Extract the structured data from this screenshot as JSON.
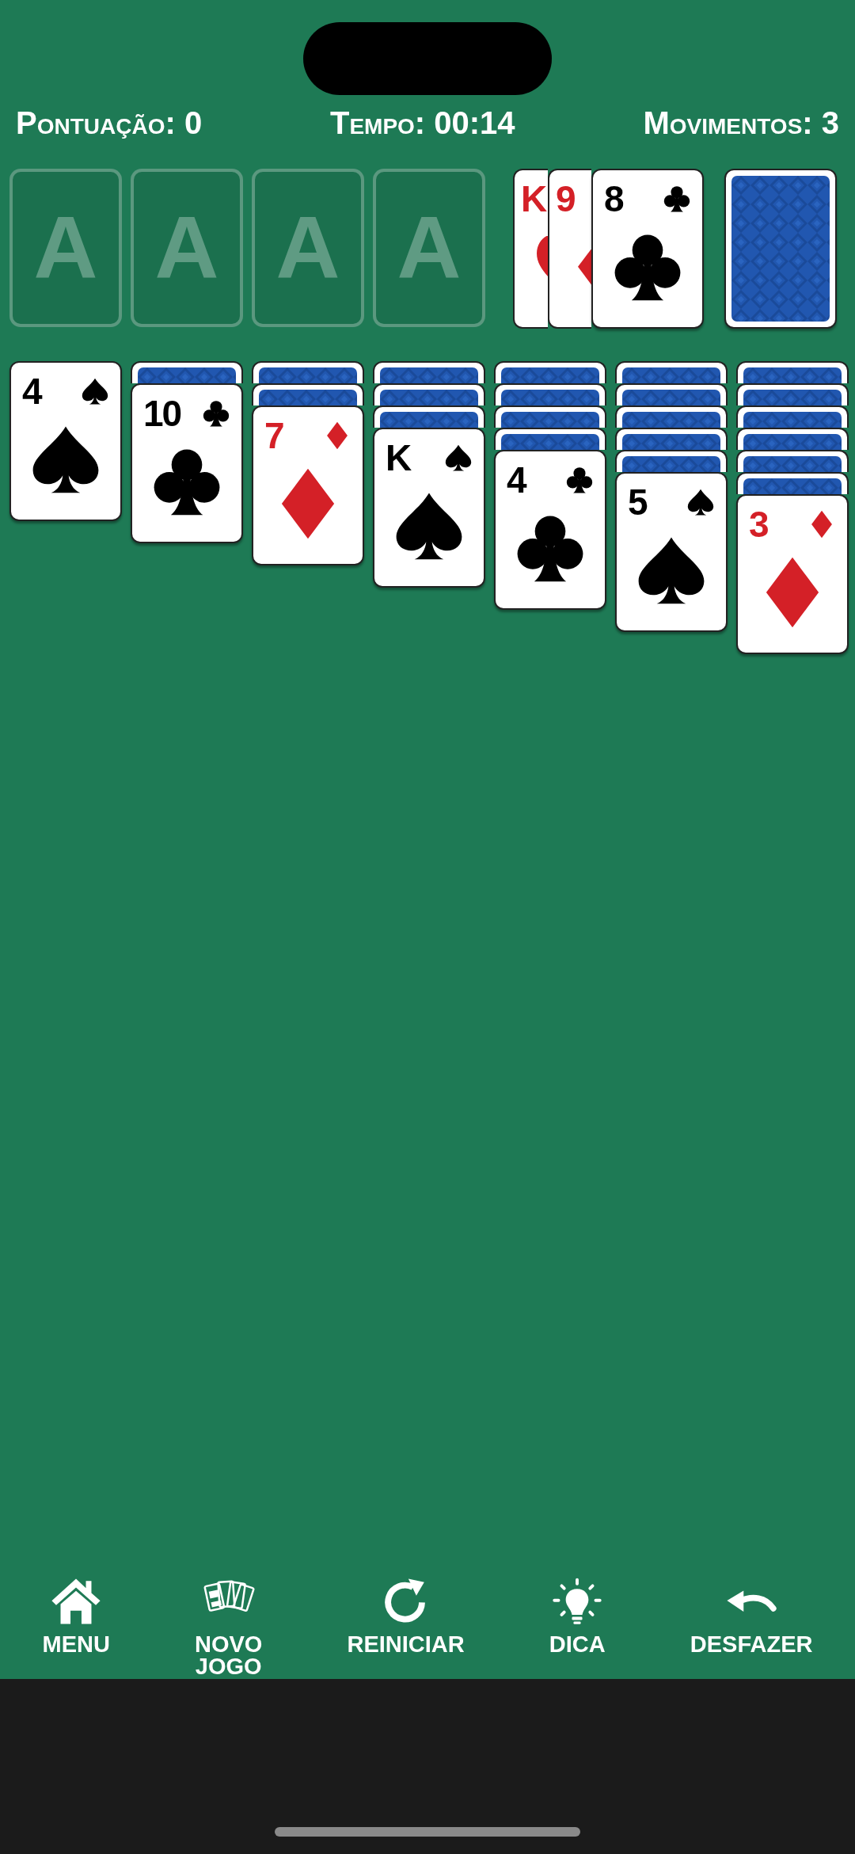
{
  "header": {
    "stats": [
      {
        "text": "Pontuação: 0"
      },
      {
        "text": "Tempo: 00:14"
      },
      {
        "text": "Movimentos: 3"
      }
    ]
  },
  "foundations": [
    {
      "label": "A"
    },
    {
      "label": "A"
    },
    {
      "label": "A"
    },
    {
      "label": "A"
    }
  ],
  "waste": {
    "cards": [
      {
        "rank": "K",
        "kind": "hearts"
      },
      {
        "rank": "9",
        "kind": "diamonds"
      },
      {
        "rank": "8",
        "kind": "clubs"
      }
    ]
  },
  "stock": {
    "face_up": false
  },
  "tableau": [
    {
      "cards": [
        {
          "face_up": true,
          "rank": "4",
          "kind": "spades"
        }
      ]
    },
    {
      "cards": [
        {
          "face_up": false
        },
        {
          "face_up": true,
          "rank": "10",
          "kind": "clubs"
        }
      ]
    },
    {
      "cards": [
        {
          "face_up": false
        },
        {
          "face_up": false
        },
        {
          "face_up": true,
          "rank": "7",
          "kind": "diamonds"
        }
      ]
    },
    {
      "cards": [
        {
          "face_up": false
        },
        {
          "face_up": false
        },
        {
          "face_up": false
        },
        {
          "face_up": true,
          "rank": "K",
          "kind": "spades"
        }
      ]
    },
    {
      "cards": [
        {
          "face_up": false
        },
        {
          "face_up": false
        },
        {
          "face_up": false
        },
        {
          "face_up": false
        },
        {
          "face_up": true,
          "rank": "4",
          "kind": "clubs"
        }
      ]
    },
    {
      "cards": [
        {
          "face_up": false
        },
        {
          "face_up": false
        },
        {
          "face_up": false
        },
        {
          "face_up": false
        },
        {
          "face_up": false
        },
        {
          "face_up": true,
          "rank": "5",
          "kind": "spades"
        }
      ]
    },
    {
      "cards": [
        {
          "face_up": false
        },
        {
          "face_up": false
        },
        {
          "face_up": false
        },
        {
          "face_up": false
        },
        {
          "face_up": false
        },
        {
          "face_up": false
        },
        {
          "face_up": true,
          "rank": "3",
          "kind": "diamonds"
        }
      ]
    }
  ],
  "toolbar": [
    {
      "kind": "home",
      "label": "MENU"
    },
    {
      "kind": "cards",
      "label": "NOVO\nJOGO"
    },
    {
      "kind": "restart",
      "label": "REINICIAR"
    },
    {
      "kind": "hint",
      "label": "DICA"
    },
    {
      "kind": "undo",
      "label": "DESFAZER"
    }
  ]
}
